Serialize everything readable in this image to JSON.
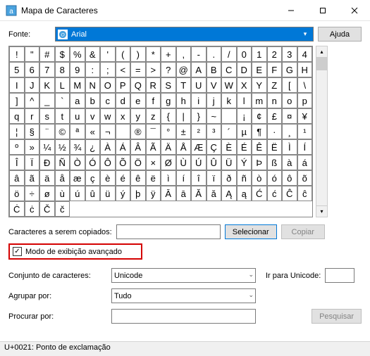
{
  "window": {
    "title": "Mapa de Caracteres",
    "app_icon": "char-map-icon"
  },
  "font_row": {
    "label": "Fonte:",
    "selected": "Arial",
    "help_button": "Ajuda"
  },
  "grid": {
    "chars": [
      "!",
      "\"",
      "#",
      "$",
      "%",
      "&",
      "'",
      "(",
      ")",
      "*",
      "+",
      ",",
      "-",
      ".",
      "/",
      "0",
      "1",
      "2",
      "3",
      "4",
      "5",
      "6",
      "7",
      "8",
      "9",
      ":",
      ";",
      "<",
      "=",
      ">",
      "?",
      "@",
      "A",
      "B",
      "C",
      "D",
      "E",
      "F",
      "G",
      "H",
      "I",
      "J",
      "K",
      "L",
      "M",
      "N",
      "O",
      "P",
      "Q",
      "R",
      "S",
      "T",
      "U",
      "V",
      "W",
      "X",
      "Y",
      "Z",
      "[",
      "\\",
      "]",
      "^",
      "_",
      "`",
      "a",
      "b",
      "c",
      "d",
      "e",
      "f",
      "g",
      "h",
      "i",
      "j",
      "k",
      "l",
      "m",
      "n",
      "o",
      "p",
      "q",
      "r",
      "s",
      "t",
      "u",
      "v",
      "w",
      "x",
      "y",
      "z",
      "{",
      "|",
      "}",
      "~",
      "",
      "¡",
      "¢",
      "£",
      "¤",
      "¥",
      "¦",
      "§",
      "¨",
      "©",
      "ª",
      "«",
      "¬",
      "­",
      "®",
      "¯",
      "°",
      "±",
      "²",
      "³",
      "´",
      "µ",
      "¶",
      "·",
      "¸",
      "¹",
      "º",
      "»",
      "¼",
      "½",
      "¾",
      "¿",
      "À",
      "Á",
      "Â",
      "Ã",
      "Ä",
      "Å",
      "Æ",
      "Ç",
      "È",
      "É",
      "Ê",
      "Ë",
      "Ì",
      "Í",
      "Î",
      "Ï",
      "Ð",
      "Ñ",
      "Ò",
      "Ó",
      "Ô",
      "Õ",
      "Ö",
      "×",
      "Ø",
      "Ù",
      "Ú",
      "Û",
      "Ü",
      "Ý",
      "Þ",
      "ß",
      "à",
      "á",
      "â",
      "ã",
      "ä",
      "å",
      "æ",
      "ç",
      "è",
      "é",
      "ê",
      "ë",
      "ì",
      "í",
      "î",
      "ï",
      "ð",
      "ñ",
      "ò",
      "ó",
      "ô",
      "õ",
      "ö",
      "÷",
      "ø",
      "ù",
      "ú",
      "û",
      "ü",
      "ý",
      "þ",
      "ÿ",
      "Ā",
      "ā",
      "Ă",
      "ă",
      "Ą",
      "ą",
      "Ć",
      "ć",
      "Ĉ",
      "ĉ",
      "Ċ",
      "ċ",
      "Č",
      "č"
    ]
  },
  "copy_row": {
    "label": "Caracteres a serem copiados:",
    "value": "",
    "select_button": "Selecionar",
    "copy_button": "Copiar"
  },
  "advanced": {
    "checkbox_label": "Modo de exibição avançado",
    "checked": true,
    "charset_label": "Conjunto de caracteres:",
    "charset_value": "Unicode",
    "goto_label": "Ir para Unicode:",
    "goto_value": "",
    "group_label": "Agrupar por:",
    "group_value": "Tudo",
    "search_label": "Procurar por:",
    "search_value": "",
    "search_button": "Pesquisar"
  },
  "statusbar": {
    "text": "U+0021: Ponto de exclamação"
  }
}
